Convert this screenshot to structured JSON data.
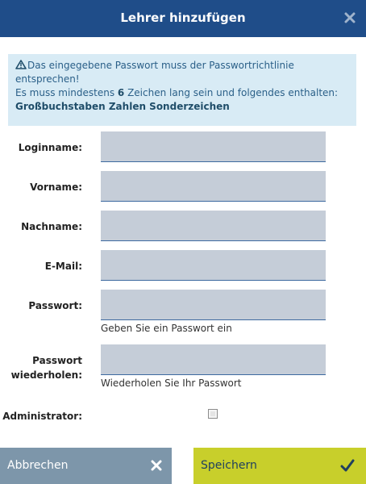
{
  "dialog": {
    "title": "Lehrer hinzufügen",
    "close_icon": "close-icon"
  },
  "alert": {
    "icon": "warning-triangle-icon",
    "line1": "Das eingegebene Passwort muss der Passwortrichtlinie entsprechen!",
    "line2_prefix": "Es muss mindestens ",
    "min_chars": "6",
    "line2_suffix": " Zeichen lang sein und folgendes enthalten:",
    "requirements": "Großbuchstaben Zahlen Sonderzeichen"
  },
  "form": {
    "login_label": "Loginname:",
    "login_value": "",
    "firstname_label": "Vorname:",
    "firstname_value": "",
    "lastname_label": "Nachname:",
    "lastname_value": "",
    "email_label": "E-Mail:",
    "email_value": "",
    "password_label": "Passwort:",
    "password_value": "",
    "password_hint": "Geben Sie ein Passwort ein",
    "repeat_label_line1": "Passwort",
    "repeat_label_line2": "wiederholen:",
    "repeat_value": "",
    "repeat_hint": "Wiederholen Sie Ihr Passwort",
    "admin_label": "Administrator:",
    "admin_checked": false
  },
  "footer": {
    "cancel_label": "Abbrechen",
    "cancel_icon": "x-icon",
    "save_label": "Speichern",
    "save_icon": "checkmark-icon"
  },
  "colors": {
    "titlebar": "#1f4d89",
    "alert_bg": "#d8ebf5",
    "field_bg": "#c5cdd8",
    "cancel_bg": "#7d96aa",
    "save_bg": "#c8cf2b"
  }
}
